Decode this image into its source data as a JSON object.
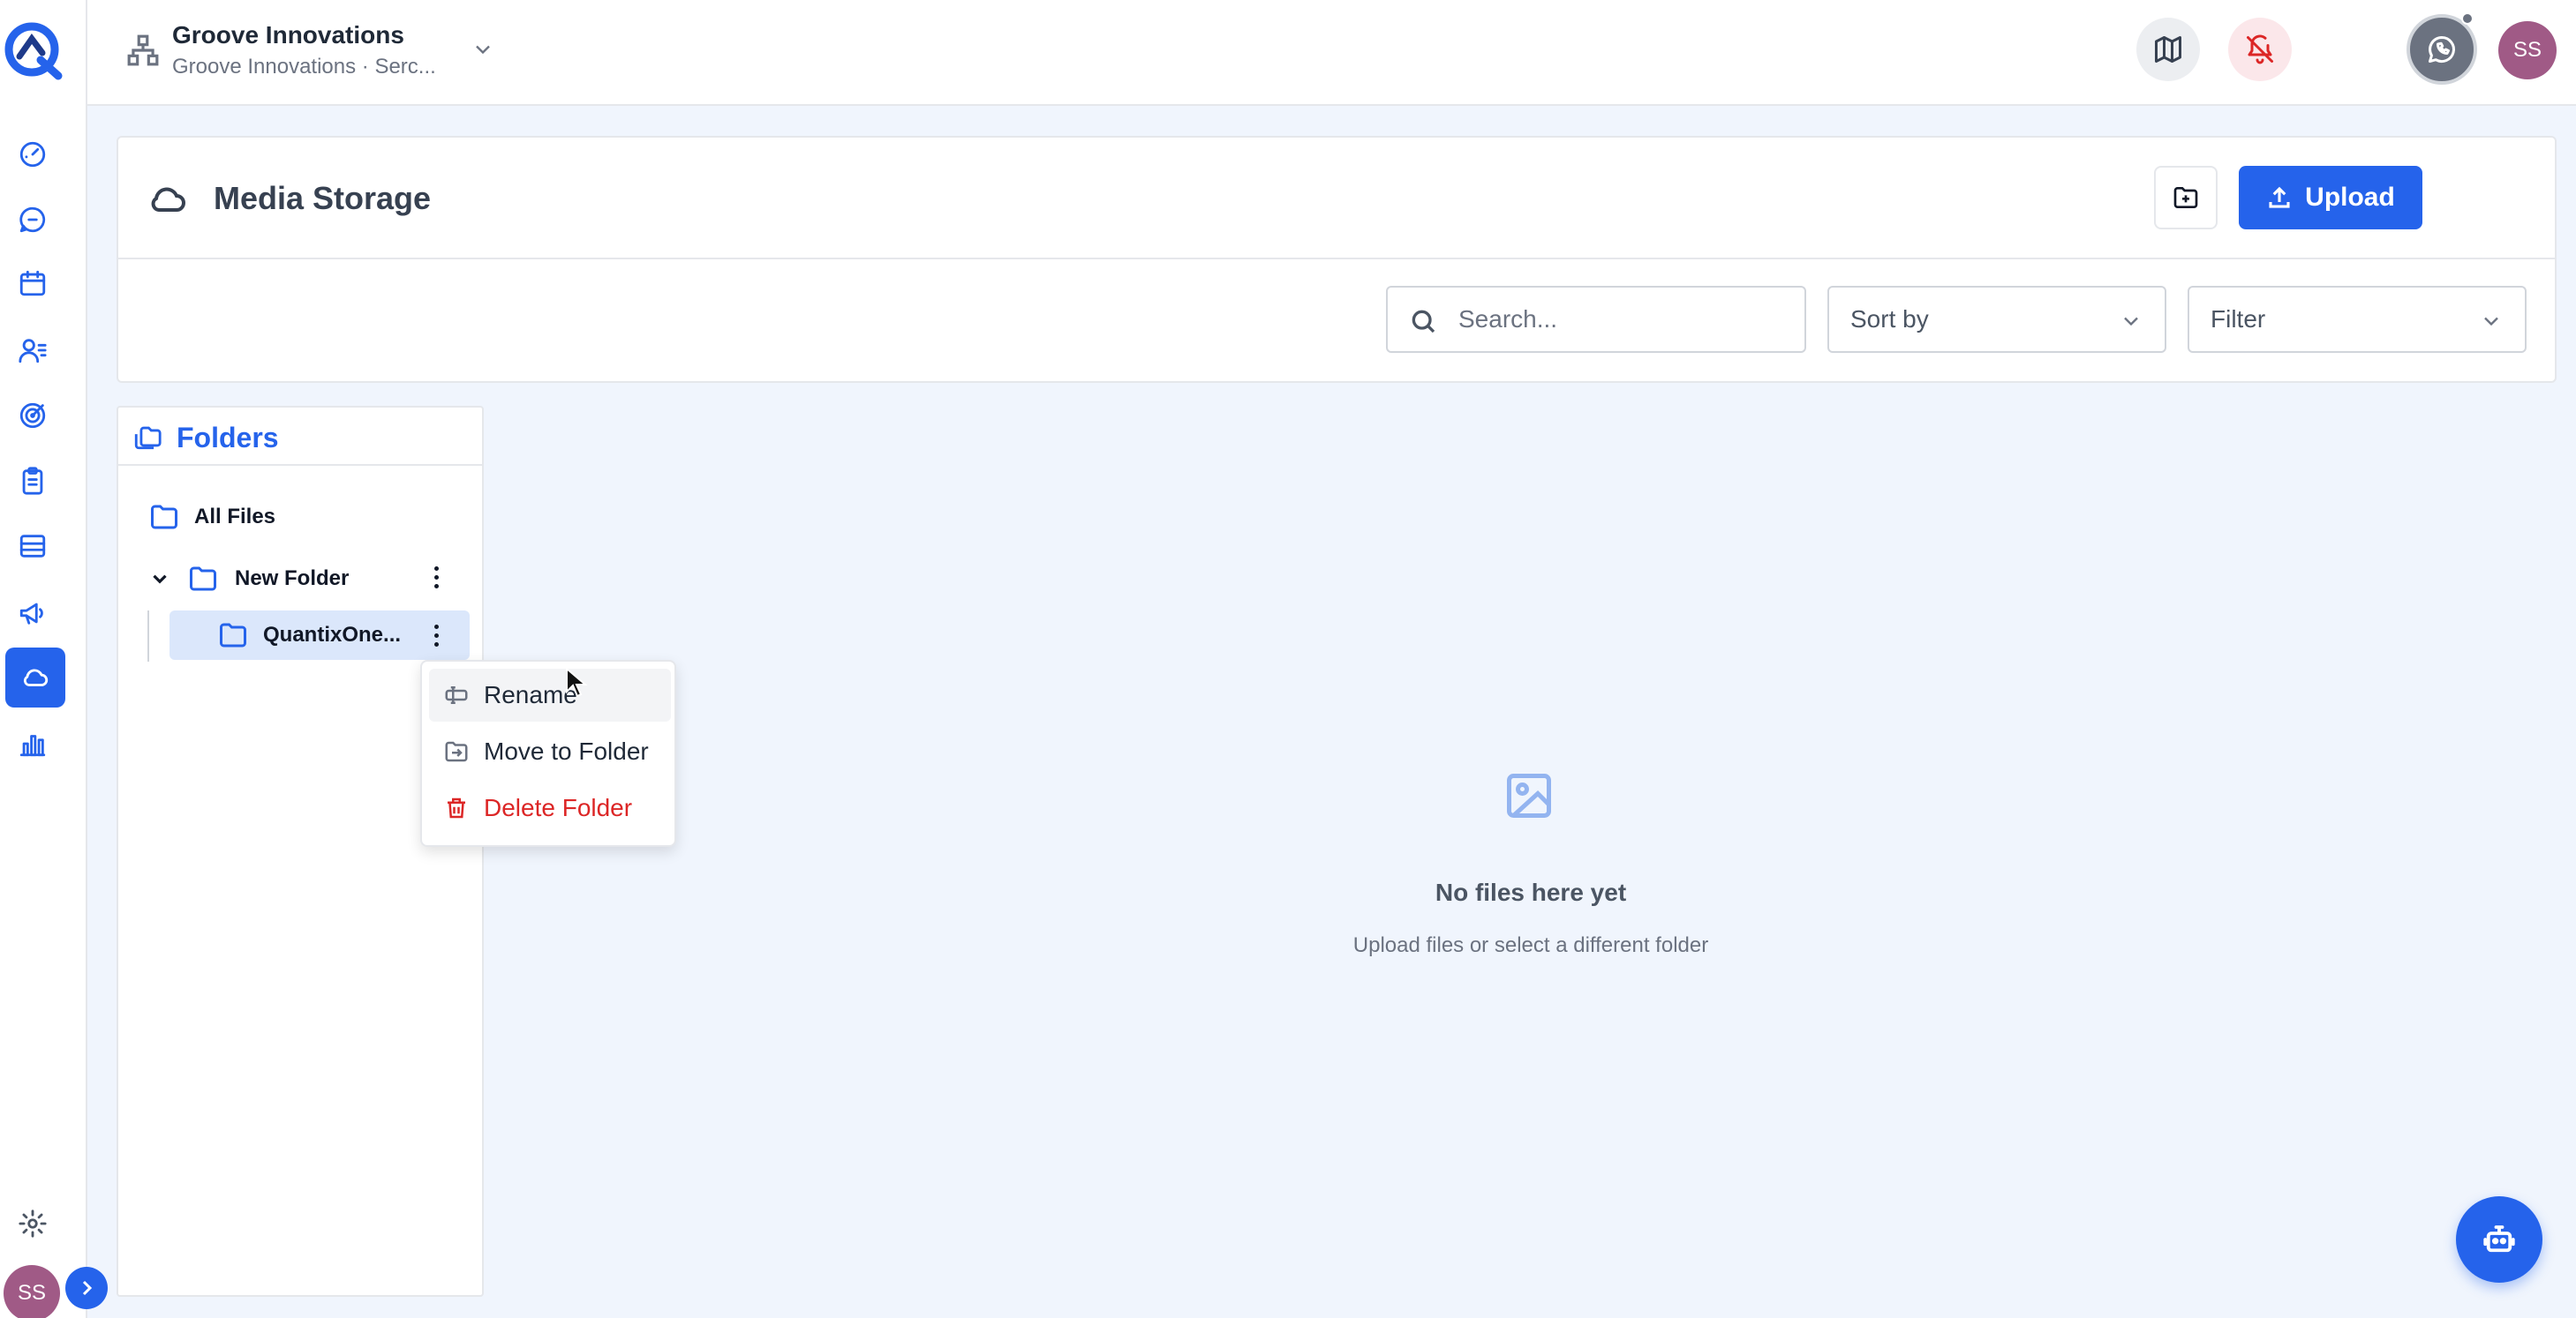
{
  "org": {
    "name": "Groove Innovations",
    "subtitle": "Groove Innovations · Serc..."
  },
  "user": {
    "initials": "SS"
  },
  "page": {
    "title": "Media Storage"
  },
  "toolbar": {
    "upload_label": "Upload",
    "search_placeholder": "Search...",
    "sort_label": "Sort by",
    "filter_label": "Filter"
  },
  "folders": {
    "title": "Folders",
    "all_files": "All Files",
    "tree": [
      {
        "label": "New Folder",
        "expanded": true
      },
      {
        "label": "QuantixOne...",
        "selected": true
      }
    ]
  },
  "context_menu": {
    "rename": "Rename",
    "move": "Move to Folder",
    "delete": "Delete Folder"
  },
  "empty_state": {
    "title": "No files here yet",
    "subtitle": "Upload files or select a different folder"
  },
  "colors": {
    "accent": "#2563eb",
    "danger": "#dc2626",
    "avatar": "#a05a86",
    "background": "#f0f5fd"
  },
  "sidebar_icons": [
    "dashboard-icon",
    "chat-icon",
    "calendar-icon",
    "contacts-icon",
    "target-icon",
    "clipboard-icon",
    "billing-icon",
    "megaphone-icon",
    "cloud-icon",
    "bar-chart-icon",
    "settings-icon"
  ]
}
